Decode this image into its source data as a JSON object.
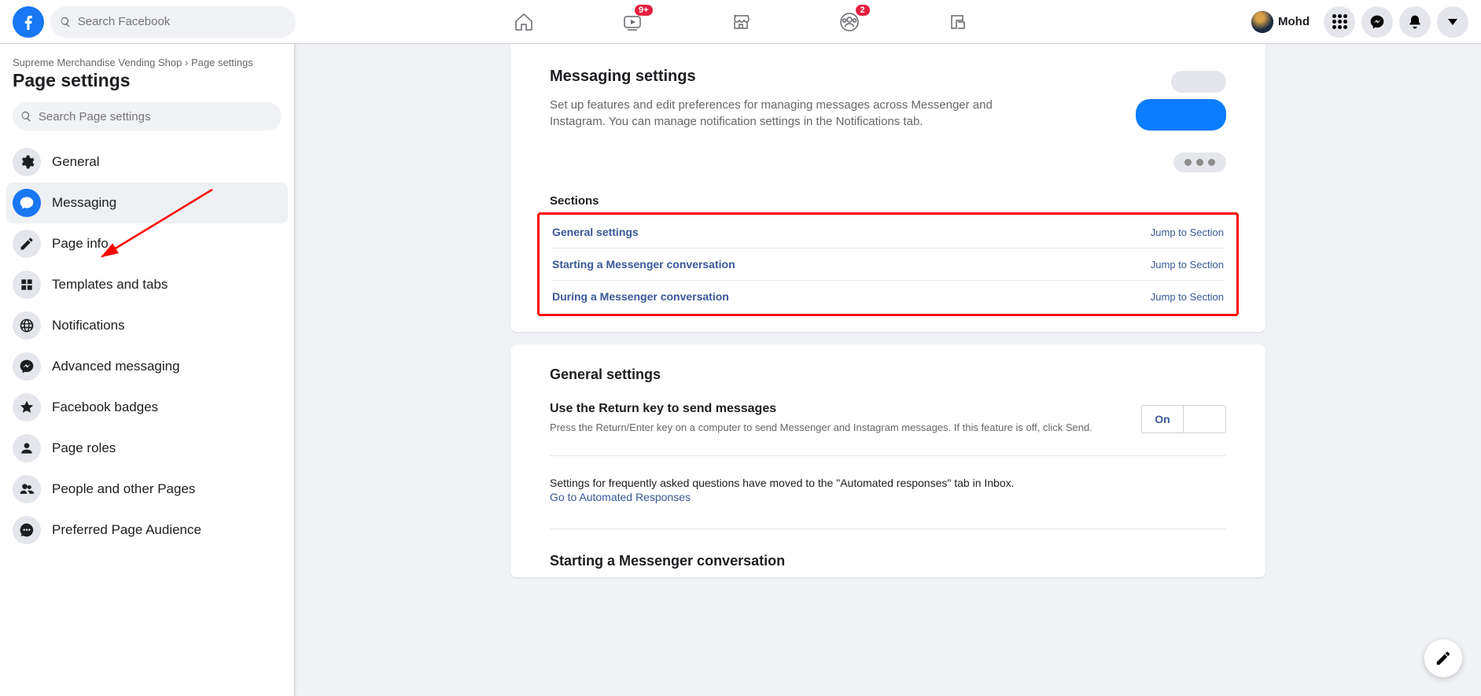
{
  "header": {
    "search_placeholder": "Search Facebook",
    "badges": {
      "watch": "9+",
      "groups": "2"
    },
    "profile_name": "Mohd"
  },
  "breadcrumb": {
    "page_name": "Supreme Merchandise Vending Shop",
    "separator": "›",
    "current": "Page settings"
  },
  "page_title": "Page settings",
  "search_settings_placeholder": "Search Page settings",
  "sidebar": {
    "items": [
      {
        "label": "General"
      },
      {
        "label": "Messaging"
      },
      {
        "label": "Page info"
      },
      {
        "label": "Templates and tabs"
      },
      {
        "label": "Notifications"
      },
      {
        "label": "Advanced messaging"
      },
      {
        "label": "Facebook badges"
      },
      {
        "label": "Page roles"
      },
      {
        "label": "People and other Pages"
      },
      {
        "label": "Preferred Page Audience"
      }
    ]
  },
  "messaging": {
    "title": "Messaging settings",
    "desc": "Set up features and edit preferences for managing messages across Messenger and Instagram. You can manage notification settings in the Notifications tab.",
    "sections_heading": "Sections",
    "jump": "Jump to Section",
    "sections": [
      {
        "label": "General settings"
      },
      {
        "label": "Starting a Messenger conversation"
      },
      {
        "label": "During a Messenger conversation"
      }
    ]
  },
  "general_settings": {
    "heading": "General settings",
    "return_key": {
      "title": "Use the Return key to send messages",
      "desc": "Press the Return/Enter key on a computer to send Messenger and Instagram messages. If this feature is off, click Send.",
      "toggle_on": "On",
      "toggle_off": ""
    },
    "faq_note": "Settings for frequently asked questions have moved to the \"Automated responses\" tab in Inbox.",
    "faq_link": "Go to Automated Responses"
  },
  "starting_heading": "Starting a Messenger conversation"
}
